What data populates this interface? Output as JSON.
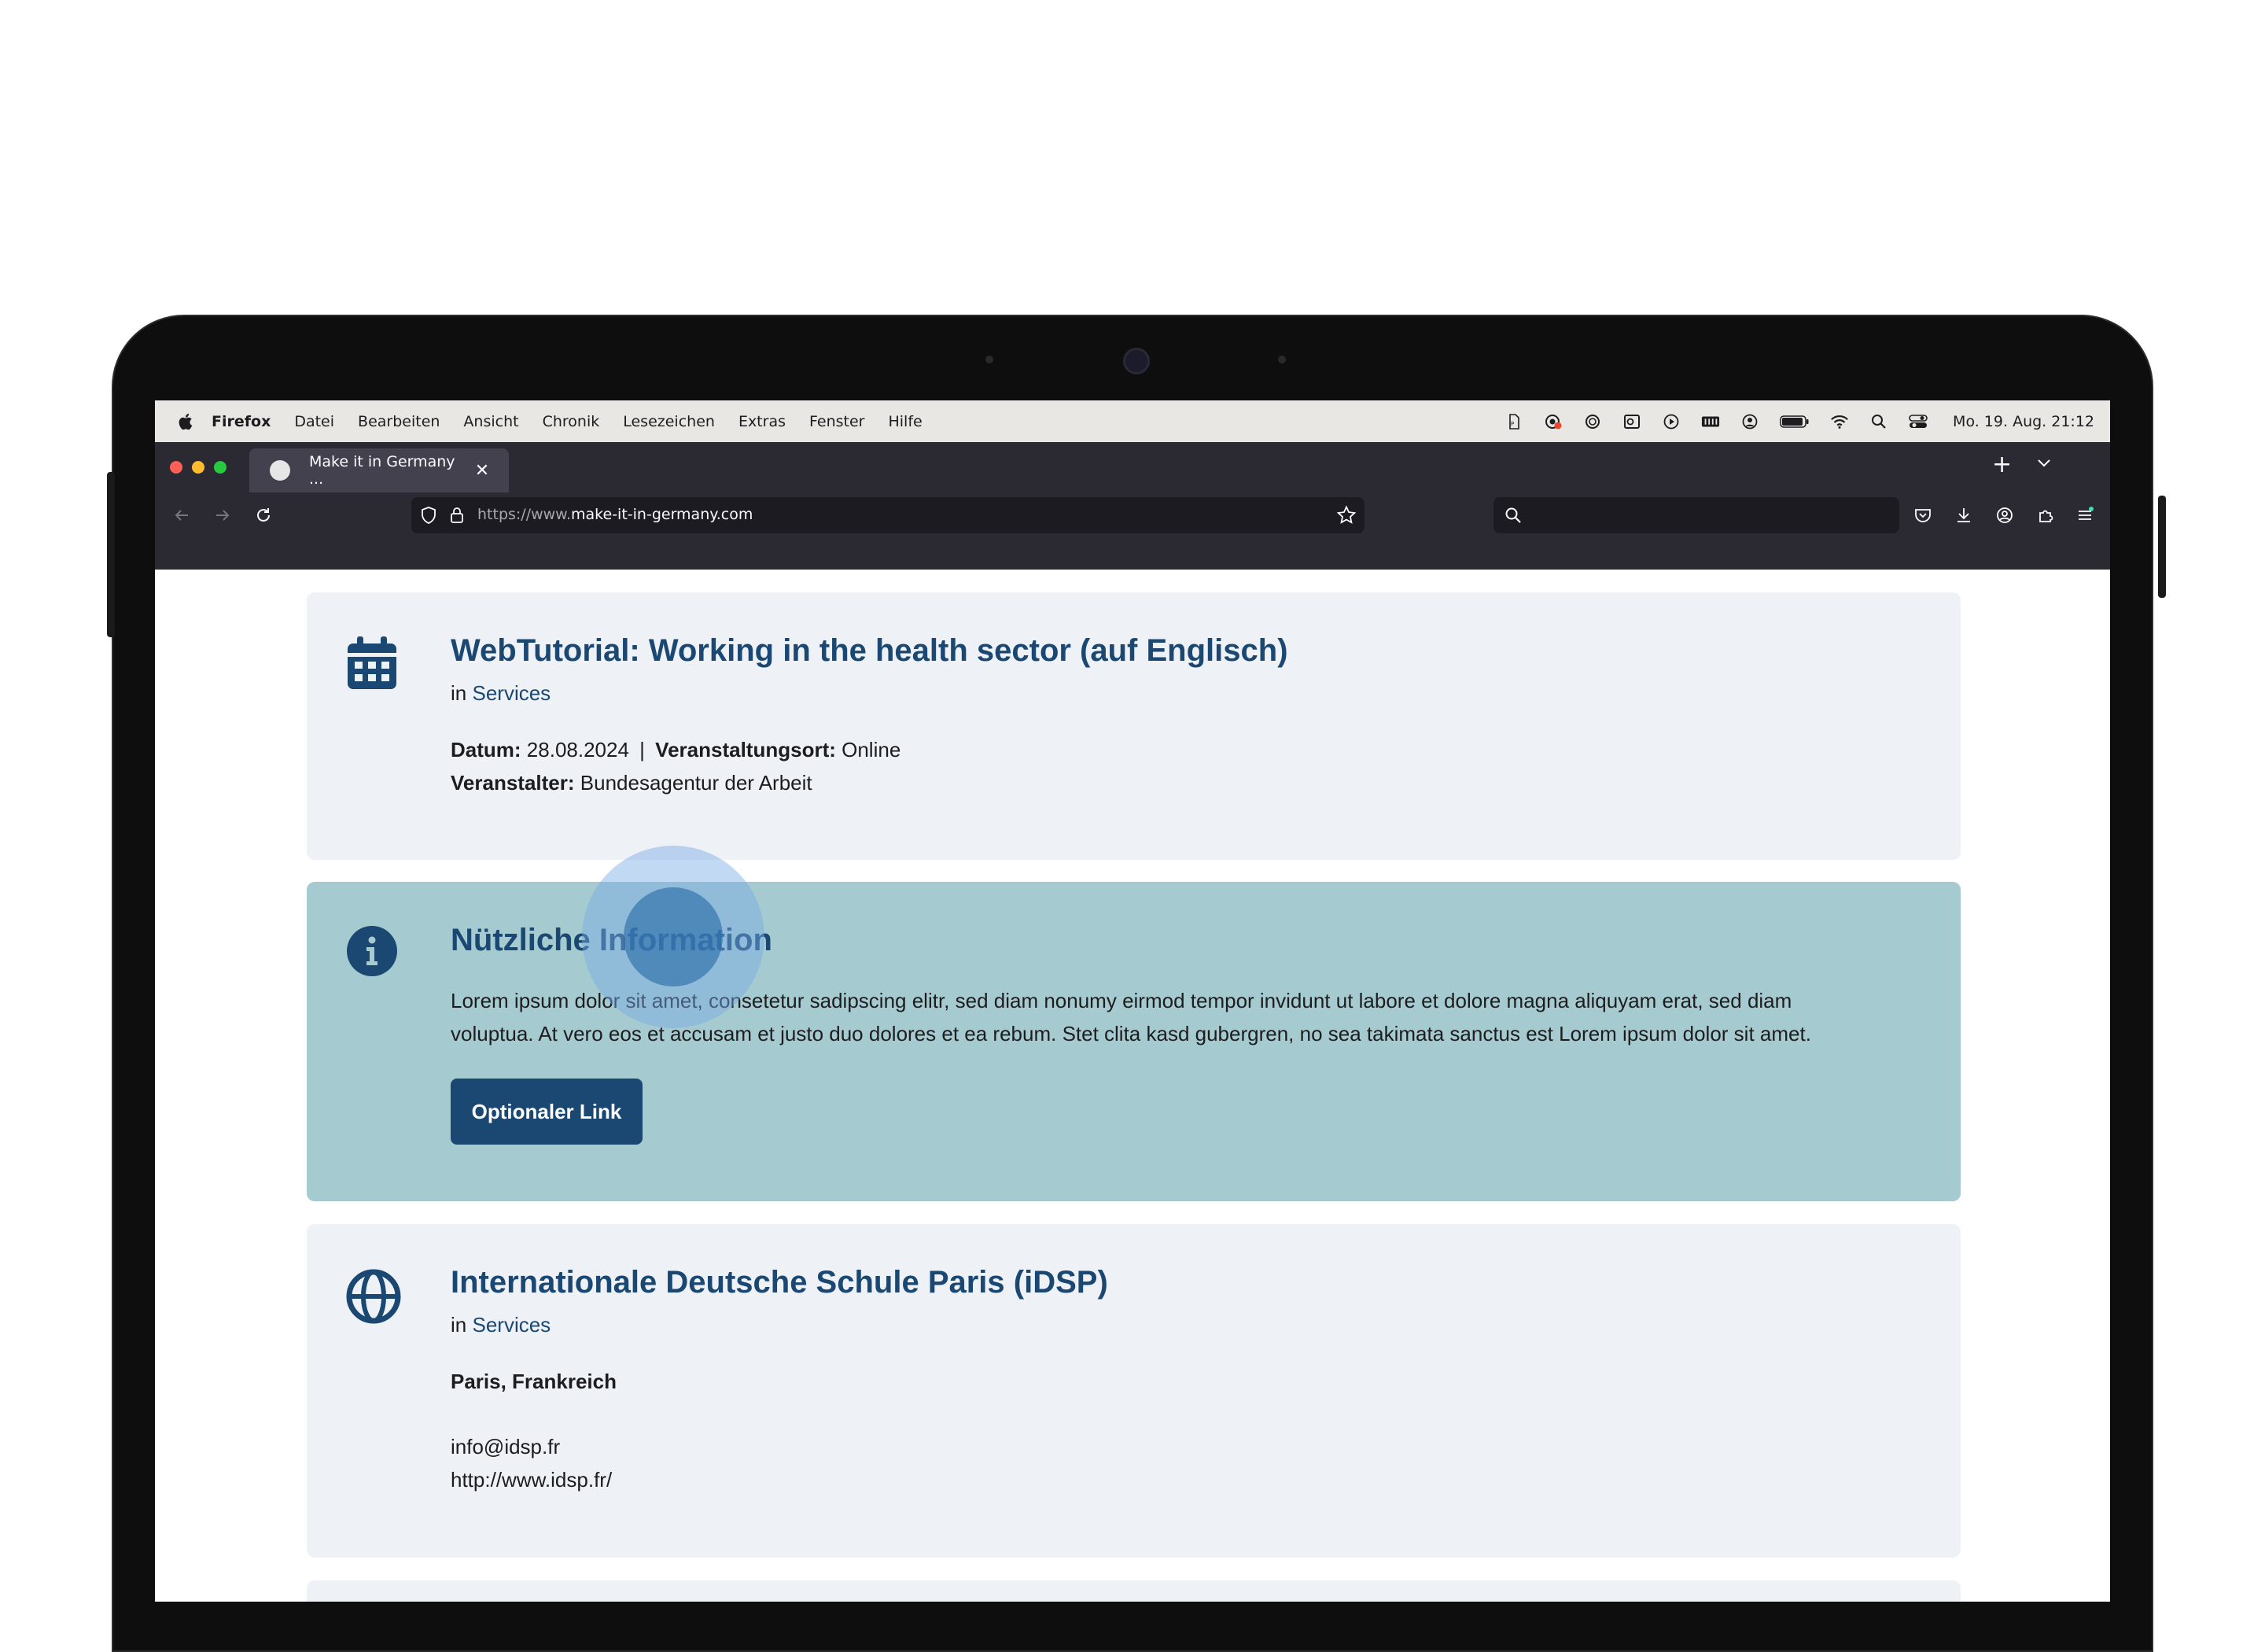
{
  "macos_menubar": {
    "app_name": "Firefox",
    "menus": [
      "Datei",
      "Bearbeiten",
      "Ansicht",
      "Chronik",
      "Lesezeichen",
      "Extras",
      "Fenster",
      "Hilfe"
    ],
    "clock": "Mo. 19. Aug.  21:12",
    "status_icons": [
      "pdf-icon",
      "record-icon",
      "chatgpt-icon",
      "outlook-icon",
      "play-icon",
      "keyboard-icon",
      "user-circle-icon",
      "battery-icon",
      "wifi-icon",
      "spotlight-search-icon",
      "control-center-icon"
    ]
  },
  "browser": {
    "tab": {
      "title": "Make it in Germany ...",
      "close": "✕"
    },
    "url": {
      "scheme_prefix": "https://www.",
      "host": "make-it-in-germany.com"
    },
    "search_placeholder": "",
    "new_tab": "+",
    "tab_list": "⌄"
  },
  "cards": [
    {
      "type": "event",
      "icon": "calendar-icon",
      "title": "WebTutorial: Working in the health sector (auf Englisch)",
      "in_prefix": "in",
      "category": "Services",
      "date_label": "Datum:",
      "date_value": "28.08.2024",
      "separator": "|",
      "venue_label": "Veranstaltungsort:",
      "venue_value": "Online",
      "organizer_label": "Veranstalter:",
      "organizer_value": "Bundesagentur der Arbeit"
    },
    {
      "type": "info",
      "icon": "info-icon",
      "title": "Nützliche Information",
      "text": "Lorem ipsum dolor sit amet, consetetur sadipscing elitr, sed diam nonumy eirmod tempor invidunt ut labore et dolore magna aliquyam erat, sed diam voluptua. At vero eos et accusam et justo duo dolores et ea rebum. Stet clita kasd gubergren, no sea takimata sanctus est Lorem ipsum dolor sit amet.",
      "button_label": "Optionaler Link"
    },
    {
      "type": "contact",
      "icon": "globe-icon",
      "title": "Internationale Deutsche Schule Paris (iDSP)",
      "in_prefix": "in",
      "category": "Services",
      "location": "Paris, Frankreich",
      "email": "info@idsp.fr",
      "website": "http://www.idsp.fr/"
    }
  ],
  "colors": {
    "heading_blue": "#1b4872",
    "card_bg": "#eef1f6",
    "info_card_bg": "#a5cbd0",
    "browser_chrome": "#2b2a33",
    "macos_menubar": "#e9e7e4"
  }
}
